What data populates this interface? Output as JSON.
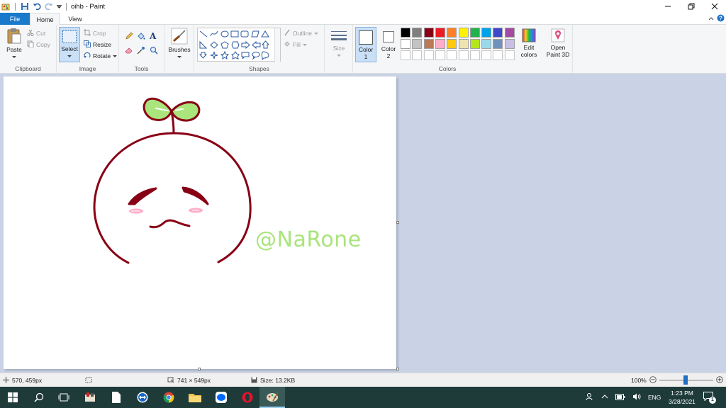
{
  "window": {
    "title": "oihb - Paint"
  },
  "tabs": {
    "file": "File",
    "home": "Home",
    "view": "View"
  },
  "ribbon": {
    "clipboard": {
      "label": "Clipboard",
      "paste": "Paste",
      "cut": "Cut",
      "copy": "Copy"
    },
    "image": {
      "label": "Image",
      "select": "Select",
      "crop": "Crop",
      "resize": "Resize",
      "rotate": "Rotate"
    },
    "tools": {
      "label": "Tools"
    },
    "brushes": {
      "label": "Brushes"
    },
    "shapes": {
      "label": "Shapes",
      "outline": "Outline",
      "fill": "Fill"
    },
    "size": {
      "label": "Size"
    },
    "colors": {
      "label": "Colors",
      "color1": "Color",
      "color1_num": "1",
      "color2": "Color",
      "color2_num": "2",
      "edit_colors_1": "Edit",
      "edit_colors_2": "colors",
      "open_3d_1": "Open",
      "open_3d_2": "Paint 3D",
      "palette_row1": [
        "#000000",
        "#7f7f7f",
        "#880015",
        "#ed1c24",
        "#ff7f27",
        "#fff200",
        "#22b14c",
        "#00a2e8",
        "#3f48cc",
        "#a349a4"
      ],
      "palette_row2": [
        "#ffffff",
        "#c3c3c3",
        "#b97a57",
        "#ffaec9",
        "#ffc90e",
        "#efe4b0",
        "#b5e61d",
        "#99d9ea",
        "#7092be",
        "#c8bfe7"
      ]
    }
  },
  "canvas": {
    "watermark": "@NaRone",
    "stroke_color": "#880015",
    "leaf_color": "#a9e47c"
  },
  "status": {
    "cursor": "570, 459px",
    "dimensions": "741 × 549px",
    "size": "Size: 13.2KB",
    "zoom": "100%"
  },
  "taskbar": {
    "language": "ENG",
    "time": "1:23 PM",
    "date": "3/28/2021",
    "notification_count": "1"
  }
}
